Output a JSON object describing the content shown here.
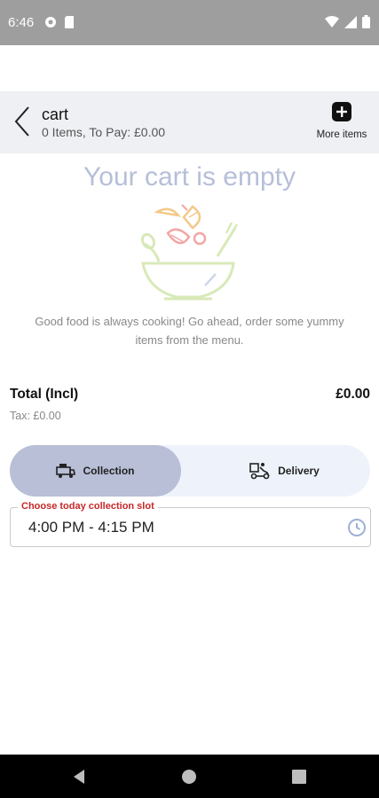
{
  "status_bar": {
    "time": "6:46",
    "left_icons": [
      "data-saver-icon",
      "sd-card-icon"
    ],
    "right_icons": [
      "wifi-icon",
      "signal-icon",
      "battery-icon"
    ]
  },
  "header": {
    "title": "cart",
    "subtitle": "0 Items, To Pay: £0.00",
    "more_items_label": "More items"
  },
  "empty_state": {
    "title": "Your cart is empty",
    "description": "Good food is always cooking! Go ahead, order some yummy items from the menu.",
    "illustration": "salad-bowl-illustration"
  },
  "totals": {
    "total_label": "Total (Incl)",
    "total_value": "£0.00",
    "tax_text": "Tax: £0.00"
  },
  "fulfillment": {
    "options": [
      {
        "label": "Collection",
        "icon": "collection-van-icon",
        "selected": true
      },
      {
        "label": "Delivery",
        "icon": "delivery-scooter-icon",
        "selected": false
      }
    ]
  },
  "slot": {
    "label": "Choose today collection slot",
    "value": "4:00 PM - 4:15 PM"
  },
  "colors": {
    "accent": "#b8bfd6",
    "toggle_bg": "#eef3fb",
    "empty_title": "#b6bfd9",
    "slot_label": "#c62828",
    "header_bg": "#eef0f3"
  },
  "nav": {
    "buttons": [
      "back-nav-icon",
      "home-nav-icon",
      "recents-nav-icon"
    ]
  }
}
